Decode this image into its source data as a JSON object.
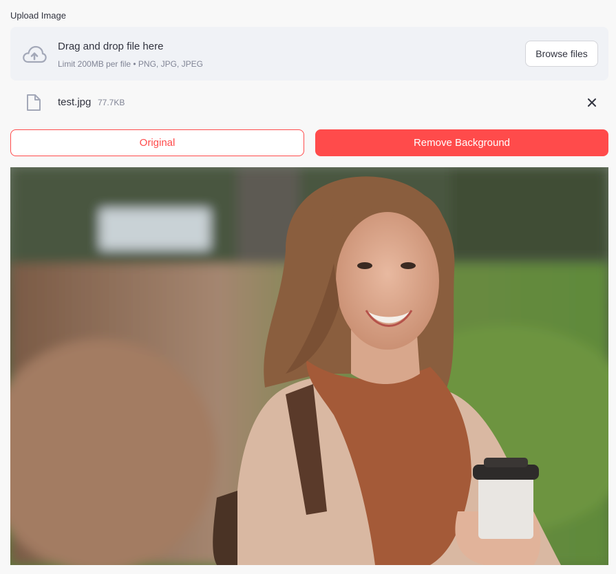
{
  "uploader": {
    "label": "Upload Image",
    "dropzone_title": "Drag and drop file here",
    "dropzone_limit": "Limit 200MB per file • PNG, JPG, JPEG",
    "browse_label": "Browse files",
    "cloud_icon": "cloud-upload-icon"
  },
  "file": {
    "name": "test.jpg",
    "size": "77.7KB",
    "icon": "file-icon",
    "remove_icon": "close-icon"
  },
  "actions": {
    "original_label": "Original",
    "remove_bg_label": "Remove Background"
  },
  "colors": {
    "primary": "#ff4b4b",
    "dropzone_bg": "#f0f2f6",
    "page_bg": "#f8f8f8",
    "text": "#31333f",
    "muted": "#808495"
  }
}
